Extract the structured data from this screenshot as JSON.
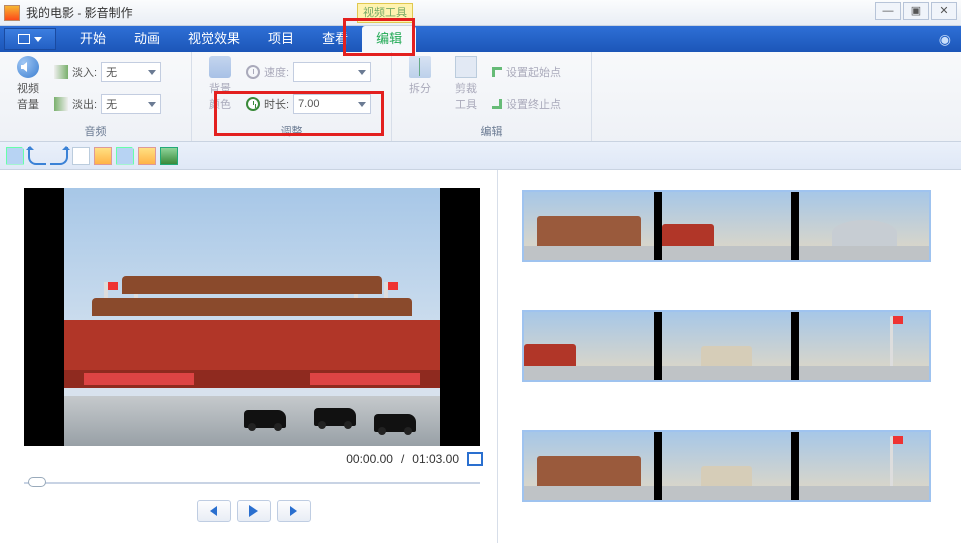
{
  "titlebar": {
    "title": "我的电影 - 影音制作",
    "context_tab": "视频工具"
  },
  "tabs": {
    "start": "开始",
    "animation": "动画",
    "visual": "视觉效果",
    "project": "项目",
    "view": "查看",
    "edit": "编辑"
  },
  "ribbon": {
    "audio": {
      "group_label": "音频",
      "volume_label": "视频\n音量",
      "fadein_label": "淡入:",
      "fadein_value": "无",
      "fadeout_label": "淡出:",
      "fadeout_value": "无"
    },
    "adjust": {
      "group_label": "调整",
      "bgcolor_label": "背景\n颜色",
      "speed_label": "速度:",
      "speed_value": "",
      "duration_label": "时长:",
      "duration_value": "7.00"
    },
    "edit": {
      "group_label": "编辑",
      "split_label": "拆分",
      "trim_label": "剪裁\n工具",
      "setstart_label": "设置起始点",
      "setend_label": "设置终止点"
    }
  },
  "preview": {
    "time_current": "00:00.00",
    "time_total": "01:03.00"
  }
}
